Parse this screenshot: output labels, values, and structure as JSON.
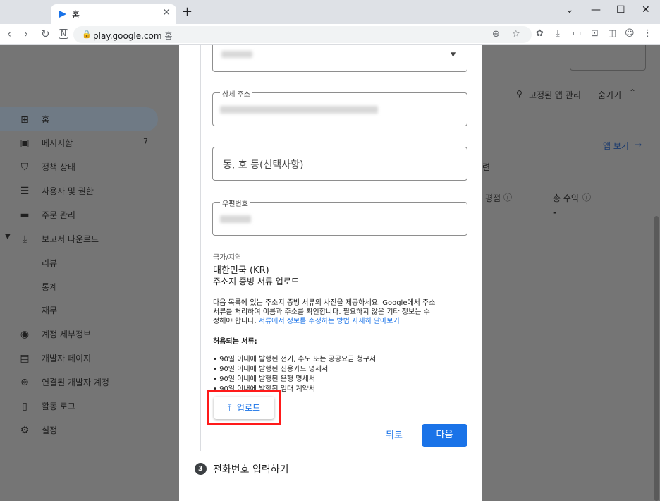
{
  "browser": {
    "tab_title": "홈",
    "new_tab": "+",
    "url": "play.google.com",
    "url_suffix": "홈",
    "window": {
      "minimize": "—",
      "maximize": "☐",
      "close": "✕",
      "tabs_menu": "⌄"
    }
  },
  "sidebar": {
    "items": [
      {
        "label": "홈",
        "icon": "grid-icon",
        "active": true
      },
      {
        "label": "메시지함",
        "icon": "inbox-icon",
        "count": "7"
      },
      {
        "label": "정책 상태",
        "icon": "shield-icon"
      },
      {
        "label": "사용자 및 권한",
        "icon": "users-icon"
      },
      {
        "label": "주문 관리",
        "icon": "card-icon"
      },
      {
        "label": "보고서 다운로드",
        "icon": "download-icon",
        "expanded": true
      },
      {
        "label": "리뷰",
        "sub": true
      },
      {
        "label": "통계",
        "sub": true
      },
      {
        "label": "재무",
        "sub": true
      },
      {
        "label": "계정 세부정보",
        "icon": "account-icon"
      },
      {
        "label": "개발자 페이지",
        "icon": "web-icon"
      },
      {
        "label": "연결된 개발자 계정",
        "icon": "link-icon"
      },
      {
        "label": "활동 로그",
        "icon": "doc-icon"
      },
      {
        "label": "설정",
        "icon": "gear-icon"
      }
    ]
  },
  "background": {
    "pinned_manage": "고정된 앱 관리",
    "hide": "숨기기",
    "app_view": "앱 보기",
    "rating": "평점",
    "total_revenue": "총 수익",
    "dash": "-",
    "partial": "련"
  },
  "dialog": {
    "detail_address_label": "상세 주소",
    "unit_placeholder": "동, 호 등(선택사항)",
    "postal_label": "우편번호",
    "country_label": "국가/지역",
    "country_value": "대한민국 (KR)",
    "upload_title": "주소지 증빙 서류 업로드",
    "desc_line1": "다음 목록에 있는 주소지 증빙 서류의 사진을 제공하세요. Google에서 주소",
    "desc_line2": "서류를 처리하여 이름과 주소를 확인합니다. 필요하지 않은 기타 정보는 수",
    "desc_line3_prefix": "정해야 합니다. ",
    "desc_link": "서류에서 정보를 수정하는 방법 자세히 알아보기",
    "allowed_heading": "허용되는 서류:",
    "allowed": [
      "• 90일 이내에 발행된 전기, 수도 또는 공공요금 청구서",
      "• 90일 이내에 발행된 신용카드 명세서",
      "• 90일 이내에 발행된 은행 명세서",
      "• 90일 이내에 발행된 임대 계약서"
    ],
    "upload_button": "업로드",
    "back_button": "뒤로",
    "next_button": "다음",
    "step_number": "3",
    "step_label": "전화번호 입력하기"
  }
}
